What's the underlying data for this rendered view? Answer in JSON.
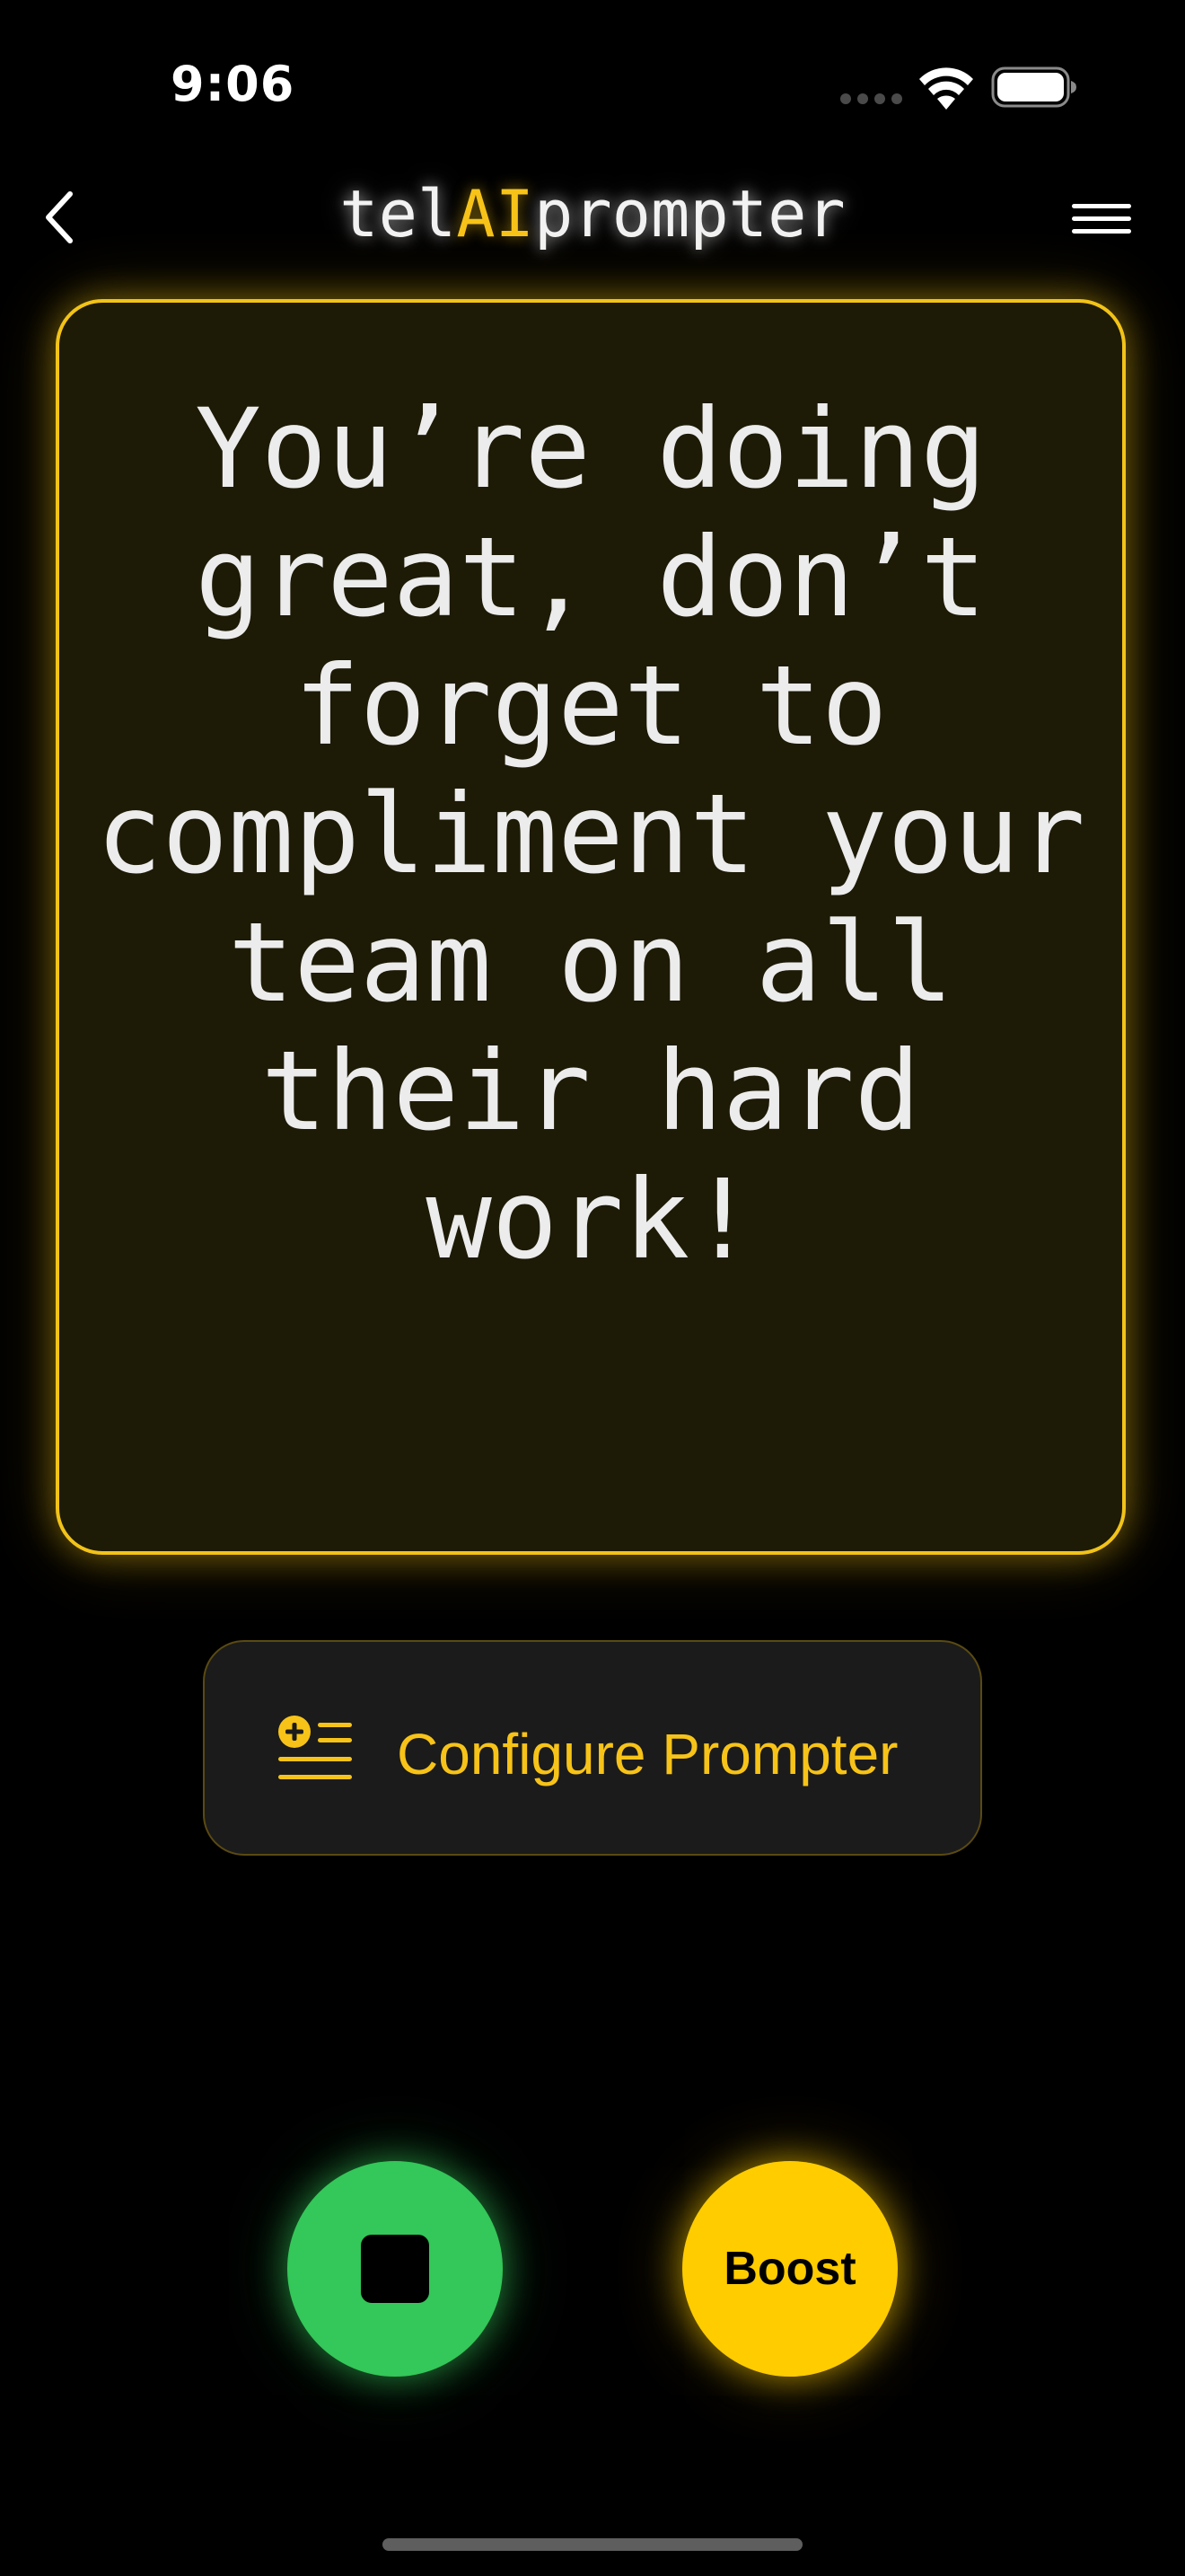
{
  "status_bar": {
    "time": "9:06"
  },
  "nav": {
    "title_prefix": "tel",
    "title_accent": "AI",
    "title_suffix": "prompter",
    "back_icon": "chevron-left-icon",
    "menu_icon": "menu-icon"
  },
  "prompt": {
    "text": "You’re doing great, don’t forget to compliment your team on all their hard work!"
  },
  "configure": {
    "label": "Configure Prompter",
    "icon": "list-add-icon"
  },
  "controls": {
    "stop_icon": "stop-icon",
    "boost_label": "Boost"
  },
  "colors": {
    "accent": "#f7c318",
    "card_background": "#1d1a06",
    "stop_green": "#34c759",
    "boost_yellow": "#ffcc00",
    "background": "#000000"
  }
}
